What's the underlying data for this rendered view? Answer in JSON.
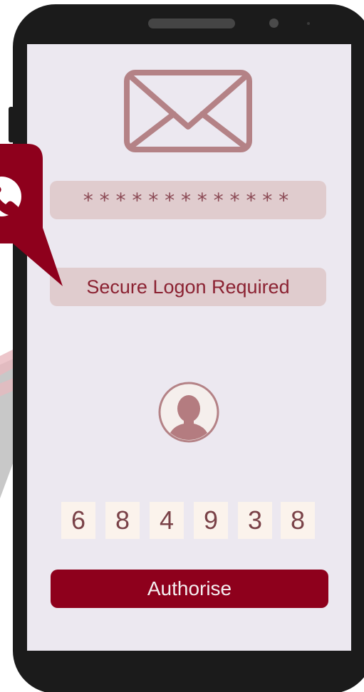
{
  "colors": {
    "phone_frame": "#1b1b1b",
    "screen_background": "#ece8f0",
    "field_background": "#e0ccce",
    "accent": "#8e001c",
    "icon_muted": "#b48286",
    "digit_background": "#fbf3ec"
  },
  "icons": {
    "envelope": "envelope-icon",
    "call_bubble": "phone-call-icon",
    "avatar": "user-avatar-icon"
  },
  "login": {
    "password_mask": "*************",
    "secure_message": "Secure Logon Required"
  },
  "otp": {
    "digits": [
      "6",
      "8",
      "4",
      "9",
      "3",
      "8"
    ]
  },
  "actions": {
    "authorise_label": "Authorise"
  }
}
